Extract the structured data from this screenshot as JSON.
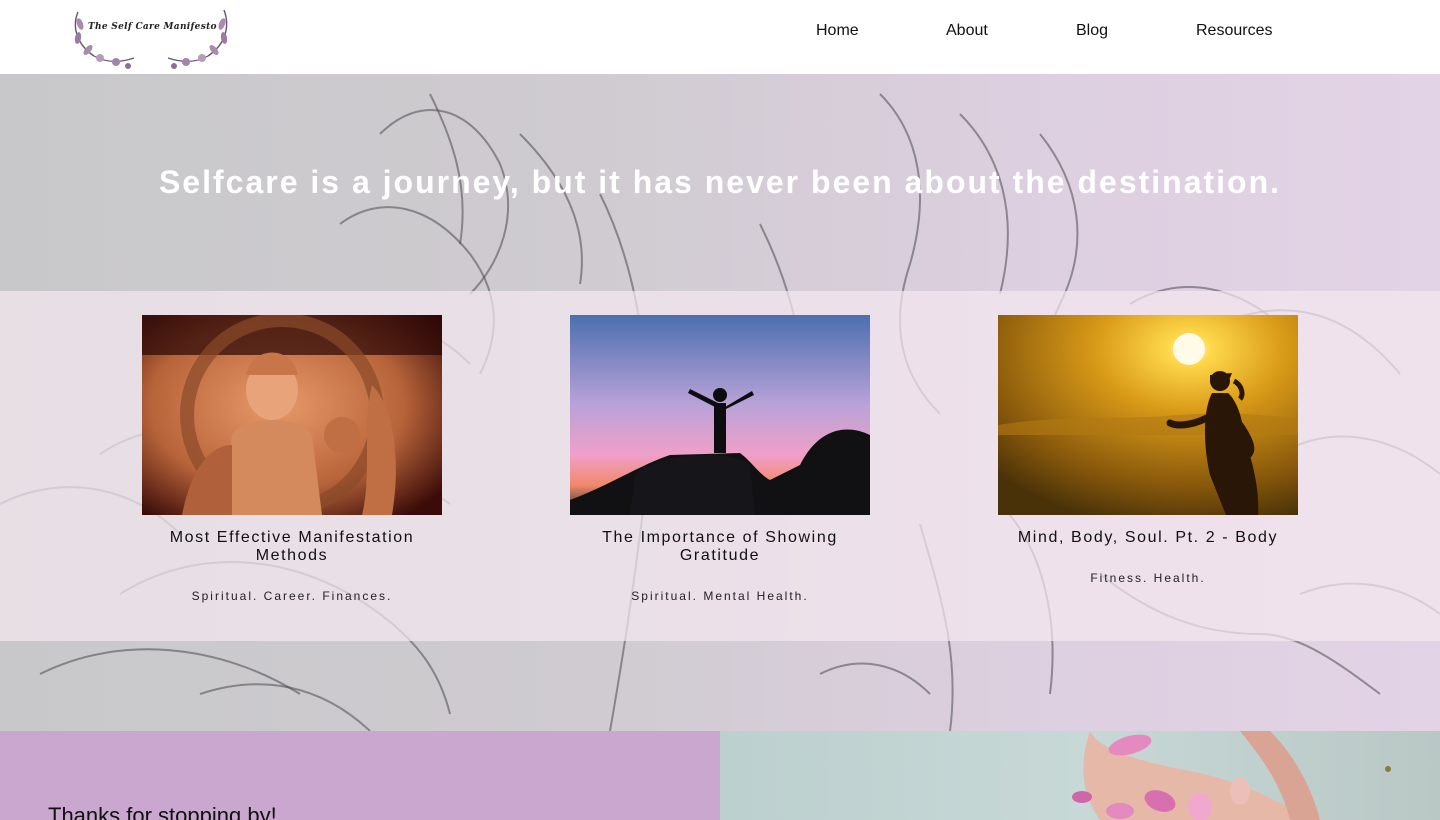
{
  "header": {
    "logo_text": "The Self Care Manifesto",
    "nav": [
      {
        "label": "Home"
      },
      {
        "label": "About"
      },
      {
        "label": "Blog"
      },
      {
        "label": "Resources"
      }
    ]
  },
  "hero": {
    "title": "Selfcare is a journey, but it has never been about the destination."
  },
  "posts": [
    {
      "title": "Most Effective Manifestation Methods",
      "tags": "Spiritual. Career. Finances.",
      "image": "carved-deity-statue"
    },
    {
      "title": "The Importance of Showing Gratitude",
      "tags": "Spiritual. Mental Health.",
      "image": "person-arms-raised-sunset"
    },
    {
      "title": "Mind, Body, Soul. Pt. 2 - Body",
      "tags": "Fitness. Health.",
      "image": "runner-silhouette-sun"
    }
  ],
  "footer": {
    "thanks": "Thanks for stopping by!"
  },
  "colors": {
    "accent_purple": "#c9a7cf",
    "hero_white_text": "#ffffff"
  }
}
